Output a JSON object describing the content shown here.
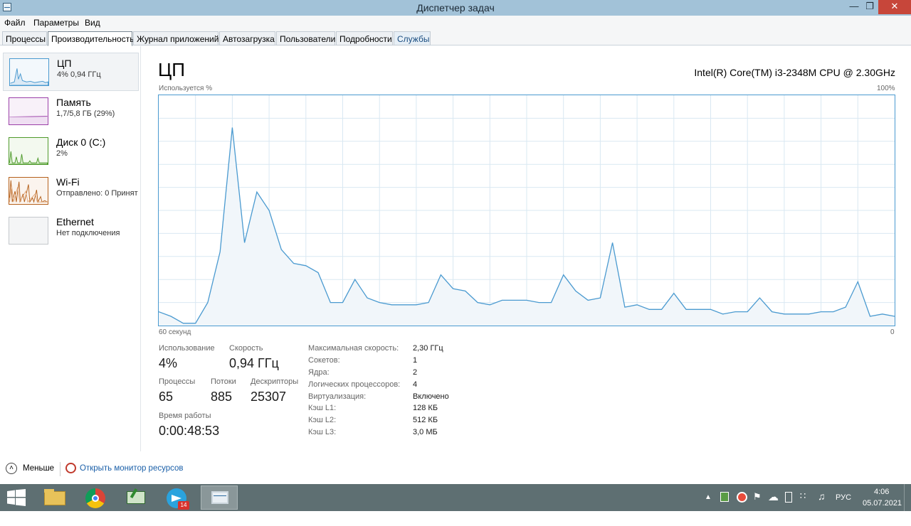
{
  "window": {
    "title": "Диспетчер задач"
  },
  "menu": {
    "file": "Файл",
    "options": "Параметры",
    "view": "Вид"
  },
  "tabs": [
    "Процессы",
    "Производительность",
    "Журнал приложений",
    "Автозагрузка",
    "Пользователи",
    "Подробности",
    "Службы"
  ],
  "sidebar": {
    "items": [
      {
        "title": "ЦП",
        "sub": "4% 0,94 ГГц",
        "icon": "cpu-graph-icon"
      },
      {
        "title": "Память",
        "sub": "1,7/5,8 ГБ (29%)",
        "icon": "memory-graph-icon"
      },
      {
        "title": "Диск 0 (C:)",
        "sub": "2%",
        "icon": "disk-graph-icon"
      },
      {
        "title": "Wi-Fi",
        "sub": "Отправлено: 0 Принят",
        "icon": "wifi-graph-icon"
      },
      {
        "title": "Ethernet",
        "sub": "Нет подключения",
        "icon": "ethernet-graph-icon"
      }
    ]
  },
  "cpu": {
    "title": "ЦП",
    "name": "Intel(R) Core(TM) i3-2348M CPU @ 2.30GHz",
    "graph_top_left": "Используется %",
    "graph_top_right": "100%",
    "graph_bottom_left": "60 секунд",
    "graph_bottom_right": "0",
    "usage_label": "Использование",
    "usage_value": "4%",
    "speed_label": "Скорость",
    "speed_value": "0,94 ГГц",
    "processes_label": "Процессы",
    "processes_value": "65",
    "threads_label": "Потоки",
    "threads_value": "885",
    "handles_label": "Дескрипторы",
    "handles_value": "25307",
    "uptime_label": "Время работы",
    "uptime_value": "0:00:48:53",
    "specs": [
      {
        "key": "Максимальная скорость:",
        "value": "2,30 ГГц"
      },
      {
        "key": "Сокетов:",
        "value": "1"
      },
      {
        "key": "Ядра:",
        "value": "2"
      },
      {
        "key": "Логических процессоров:",
        "value": "4"
      },
      {
        "key": "Виртуализация:",
        "value": "Включено"
      },
      {
        "key": "Кэш L1:",
        "value": "128 КБ"
      },
      {
        "key": "Кэш L2:",
        "value": "512 КБ"
      },
      {
        "key": "Кэш L3:",
        "value": "3,0 МБ"
      }
    ]
  },
  "chart_data": {
    "type": "area",
    "title": "",
    "xlabel": "60 секунд",
    "ylabel": "Используется %",
    "ylim": [
      0,
      100
    ],
    "x": [
      60,
      59,
      58,
      57,
      56,
      55,
      54,
      53,
      52,
      51,
      50,
      49,
      48,
      47,
      46,
      45,
      44,
      43,
      42,
      41,
      40,
      39,
      38,
      37,
      36,
      35,
      34,
      33,
      32,
      31,
      30,
      29,
      28,
      27,
      26,
      25,
      24,
      23,
      22,
      21,
      20,
      19,
      18,
      17,
      16,
      15,
      14,
      13,
      12,
      11,
      10,
      9,
      8,
      7,
      6,
      5,
      4,
      3,
      2,
      1,
      0
    ],
    "values": [
      6,
      4,
      1,
      1,
      10,
      32,
      86,
      36,
      58,
      50,
      33,
      27,
      26,
      23,
      10,
      10,
      20,
      12,
      10,
      9,
      9,
      9,
      10,
      22,
      16,
      15,
      10,
      9,
      11,
      11,
      11,
      10,
      10,
      22,
      15,
      11,
      12,
      36,
      8,
      9,
      7,
      7,
      14,
      7,
      7,
      7,
      5,
      6,
      6,
      12,
      6,
      5,
      5,
      5,
      6,
      6,
      8,
      19,
      4,
      5,
      4
    ],
    "colors": {
      "line": "#4a9ad0",
      "fill": "#f1f6fa",
      "grid": "#d9e8f2"
    }
  },
  "bottom": {
    "fewer": "Меньше",
    "resmon": "Открыть монитор ресурсов"
  },
  "taskbar": {
    "lang": "РУС",
    "time": "4:06",
    "date": "05.07.2021",
    "telegram_badge": "14"
  }
}
